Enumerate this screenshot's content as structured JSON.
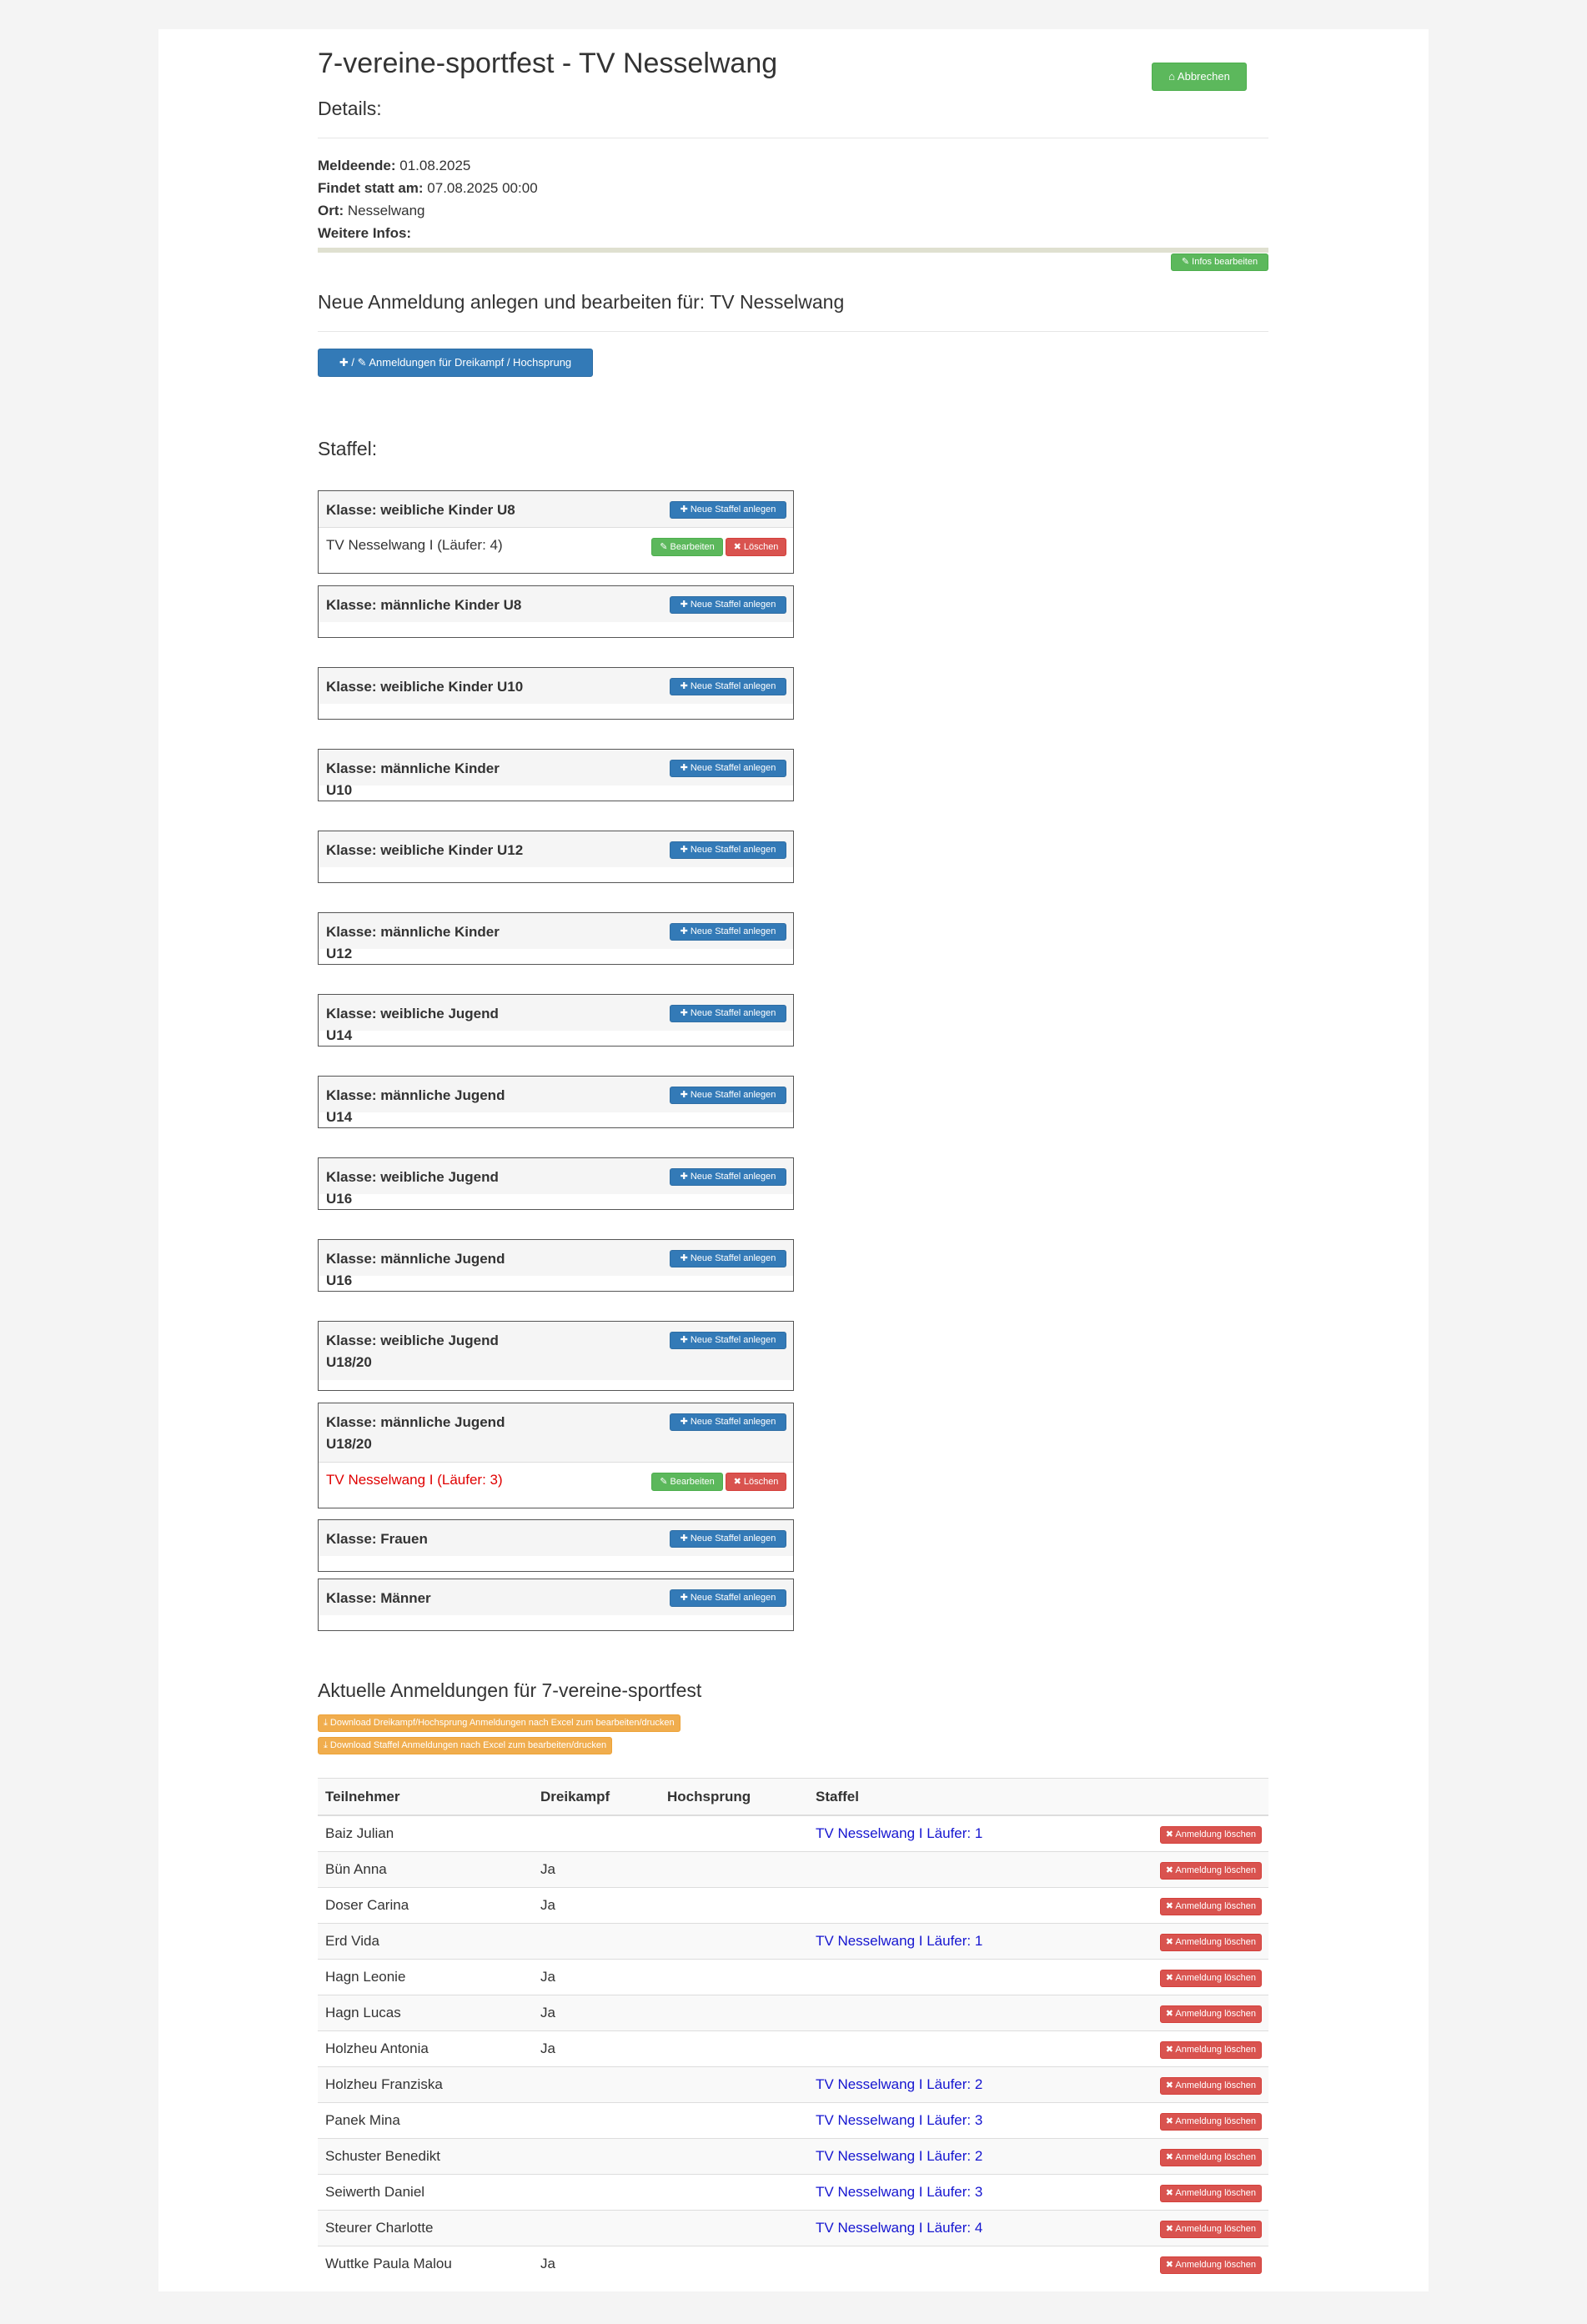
{
  "header": {
    "title": "7-vereine-sportfest - TV Nesselwang",
    "abort_label": "⌂ Abbrechen"
  },
  "details": {
    "heading": "Details:",
    "deadline_label": "Meldeende:",
    "deadline_value": "01.08.2025",
    "date_label": "Findet statt am:",
    "date_value": "07.08.2025 00:00",
    "place_label": "Ort:",
    "place_value": "Nesselwang",
    "info_label": "Weitere Infos:",
    "edit_infos_label": "✎ Infos bearbeiten"
  },
  "registration": {
    "heading": "Neue Anmeldung anlegen und bearbeiten für: TV Nesselwang",
    "create_label": "✚ / ✎ Anmeldungen für Dreikampf / Hochsprung"
  },
  "staffel": {
    "heading": "Staffel:",
    "new_label": "✚ Neue Staffel anlegen",
    "edit_label": "✎ Bearbeiten",
    "delete_label": "✖ Löschen",
    "classes": [
      {
        "label": "Klasse: weibliche Kinder U8",
        "teams": [
          {
            "name": "TV Nesselwang I (Läufer: 4)",
            "highlight": false
          }
        ]
      },
      {
        "label": "Klasse: männliche Kinder U8",
        "teams": []
      },
      {
        "label": "Klasse: weibliche Kinder U10",
        "teams": []
      },
      {
        "label": "Klasse: männliche Kinder U10",
        "teams": []
      },
      {
        "label": "Klasse: weibliche Kinder U12",
        "teams": []
      },
      {
        "label": "Klasse: männliche Kinder U12",
        "teams": []
      },
      {
        "label": "Klasse: weibliche Jugend U14",
        "teams": []
      },
      {
        "label": "Klasse: männliche Jugend U14",
        "teams": []
      },
      {
        "label": "Klasse: weibliche Jugend U16",
        "teams": []
      },
      {
        "label": "Klasse: männliche Jugend U16",
        "teams": []
      },
      {
        "label": "Klasse: weibliche Jugend U18/20",
        "teams": []
      },
      {
        "label": "Klasse: männliche Jugend U18/20",
        "teams": [
          {
            "name": "TV Nesselwang I (Läufer: 3)",
            "highlight": true
          }
        ]
      },
      {
        "label": "Klasse: Frauen",
        "teams": []
      },
      {
        "label": "Klasse: Männer",
        "teams": []
      }
    ]
  },
  "current": {
    "heading": "Aktuelle Anmeldungen für 7-vereine-sportfest",
    "download1": "⤓ Download Dreikampf/Hochsprung Anmeldungen nach Excel zum bearbeiten/drucken",
    "download2": "⤓ Download Staffel Anmeldungen nach Excel zum bearbeiten/drucken",
    "columns": [
      "Teilnehmer",
      "Dreikampf",
      "Hochsprung",
      "Staffel",
      ""
    ],
    "delete_label": "✖ Anmeldung löschen",
    "rows": [
      {
        "name": "Baiz Julian",
        "dreikampf": "",
        "hochsprung": "",
        "staffel": "TV Nesselwang I Läufer: 1"
      },
      {
        "name": "Bün Anna",
        "dreikampf": "Ja",
        "hochsprung": "",
        "staffel": ""
      },
      {
        "name": "Doser Carina",
        "dreikampf": "Ja",
        "hochsprung": "",
        "staffel": ""
      },
      {
        "name": "Erd Vida",
        "dreikampf": "",
        "hochsprung": "",
        "staffel": "TV Nesselwang I Läufer: 1"
      },
      {
        "name": "Hagn Leonie",
        "dreikampf": "Ja",
        "hochsprung": "",
        "staffel": ""
      },
      {
        "name": "Hagn Lucas",
        "dreikampf": "Ja",
        "hochsprung": "",
        "staffel": ""
      },
      {
        "name": "Holzheu Antonia",
        "dreikampf": "Ja",
        "hochsprung": "",
        "staffel": ""
      },
      {
        "name": "Holzheu Franziska",
        "dreikampf": "",
        "hochsprung": "",
        "staffel": "TV Nesselwang I Läufer: 2"
      },
      {
        "name": "Panek Mina",
        "dreikampf": "",
        "hochsprung": "",
        "staffel": "TV Nesselwang I Läufer: 3"
      },
      {
        "name": "Schuster Benedikt",
        "dreikampf": "",
        "hochsprung": "",
        "staffel": "TV Nesselwang I Läufer: 2"
      },
      {
        "name": "Seiwerth Daniel",
        "dreikampf": "",
        "hochsprung": "",
        "staffel": "TV Nesselwang I Läufer: 3"
      },
      {
        "name": "Steurer Charlotte",
        "dreikampf": "",
        "hochsprung": "",
        "staffel": "TV Nesselwang I Läufer: 4"
      },
      {
        "name": "Wuttke Paula Malou",
        "dreikampf": "Ja",
        "hochsprung": "",
        "staffel": ""
      }
    ]
  }
}
